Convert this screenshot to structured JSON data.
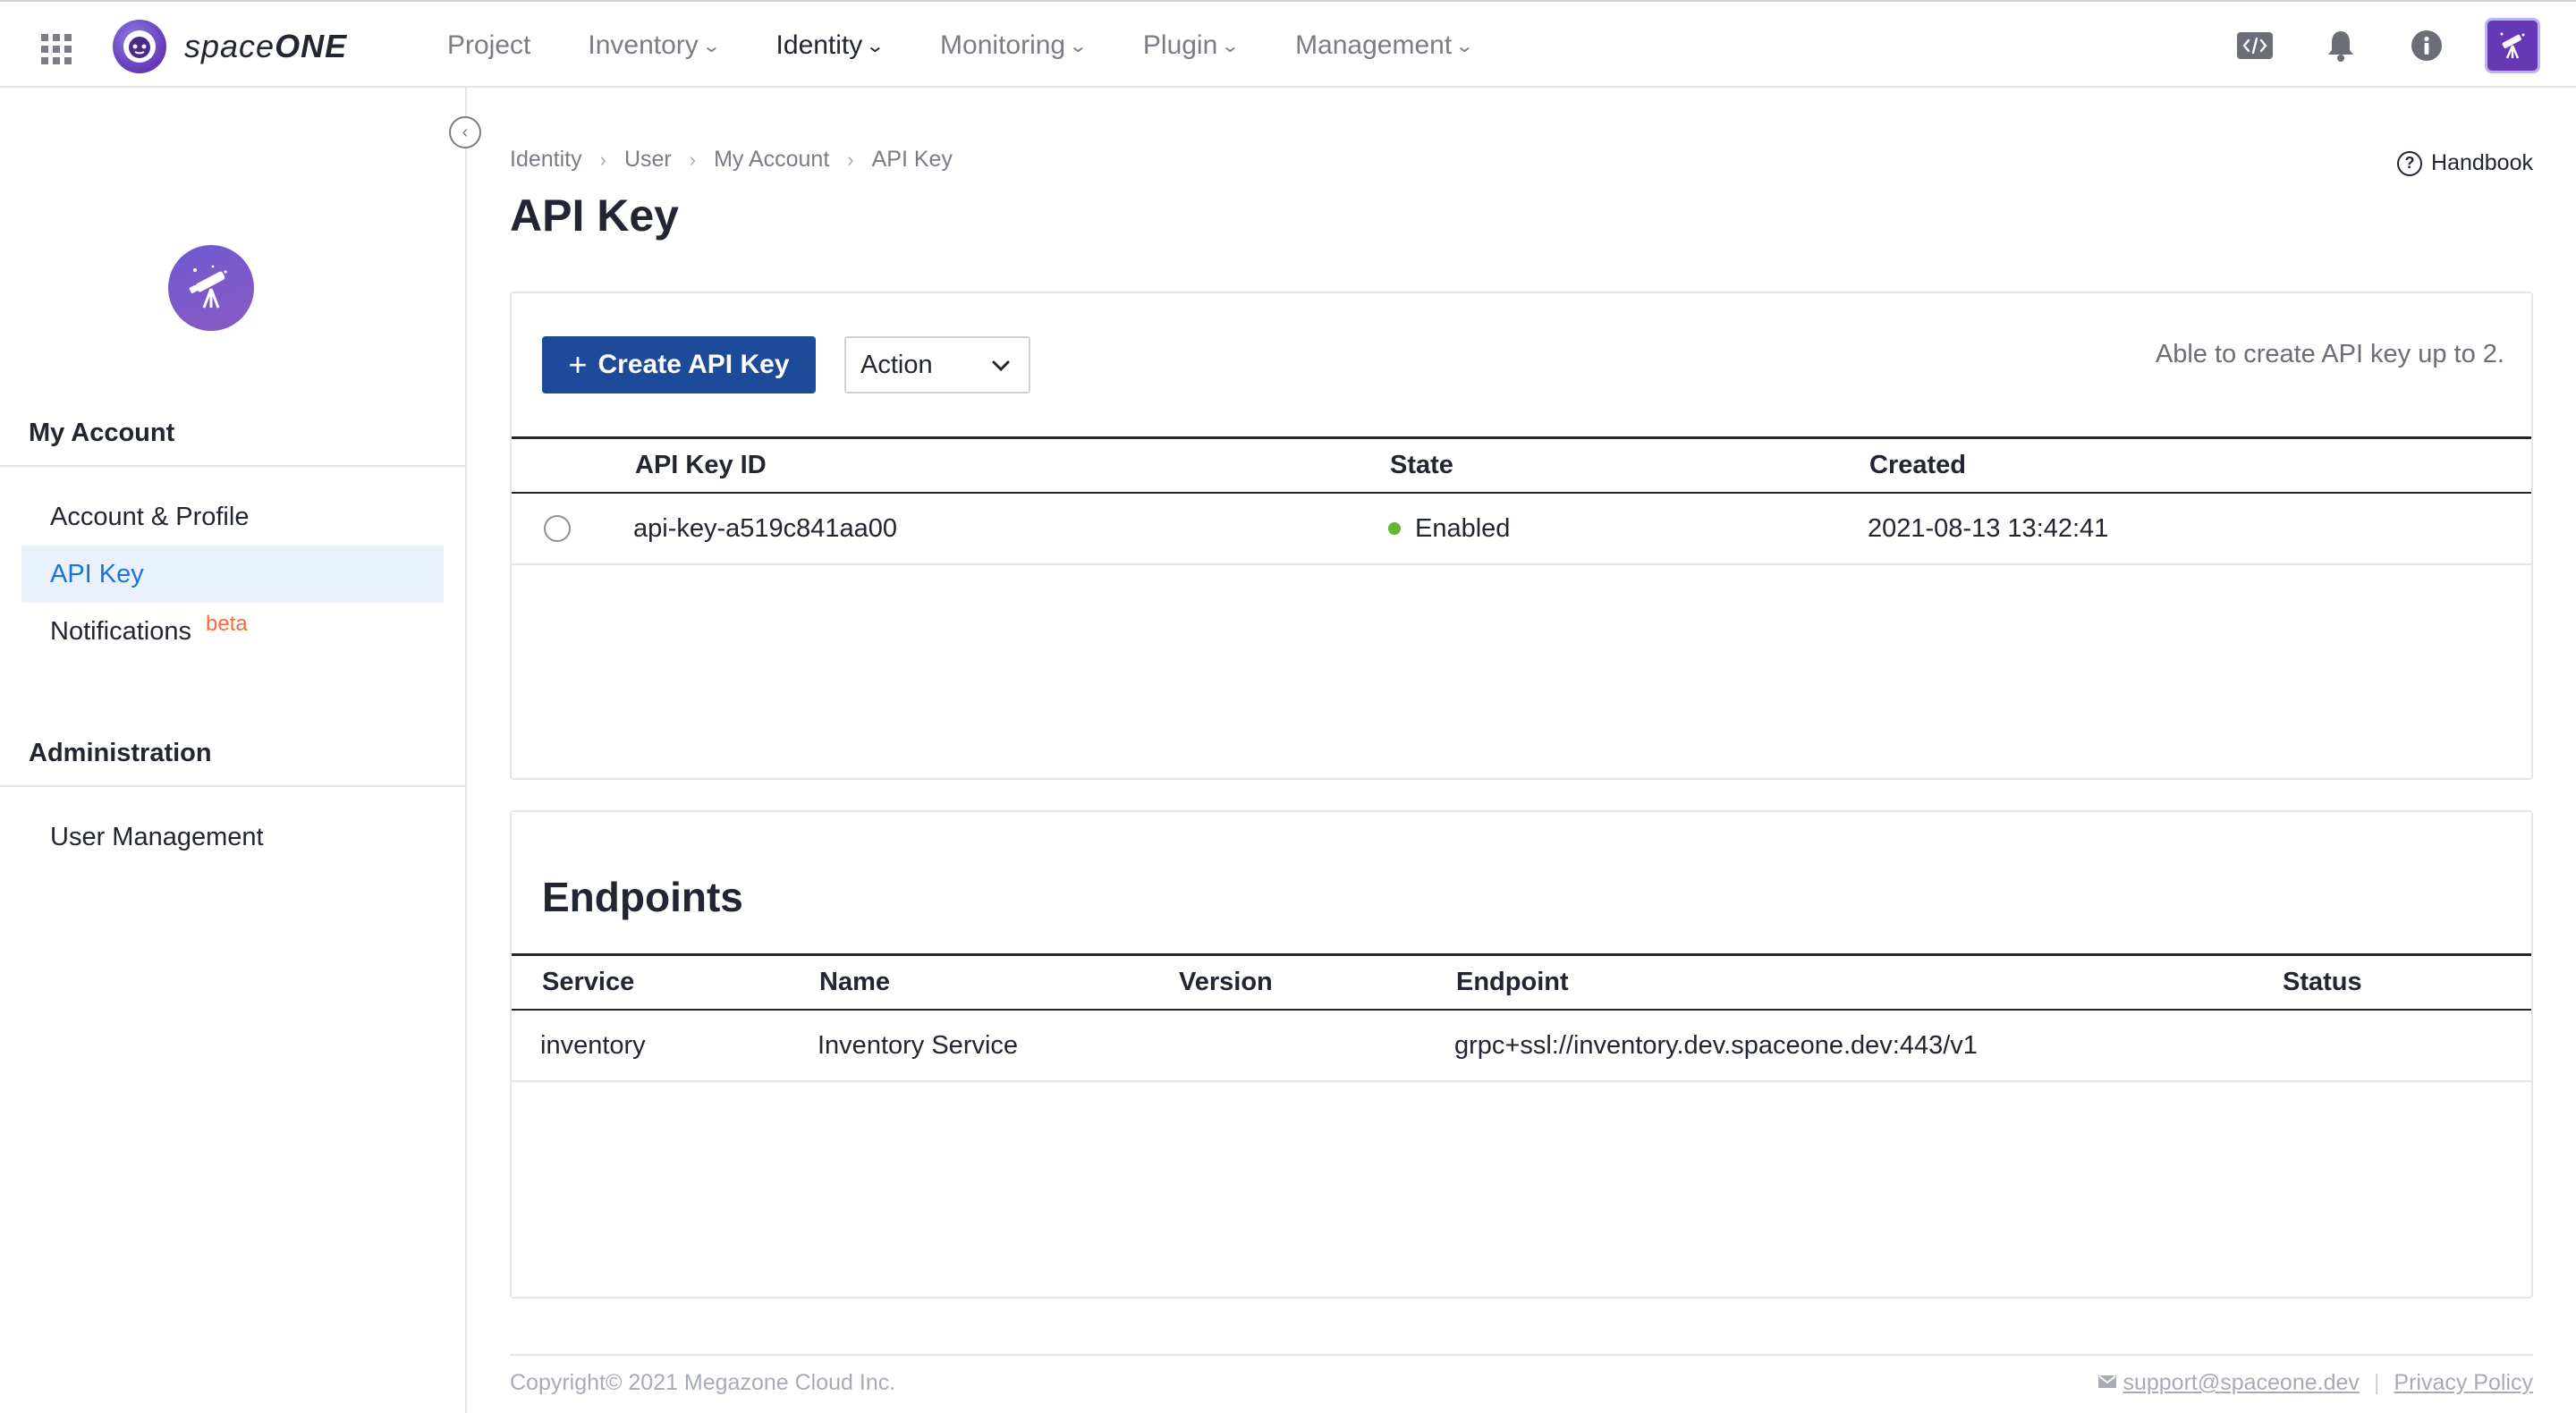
{
  "app": {
    "logo_text_light": "space",
    "logo_text_bold": "ONE",
    "brand_color": "#6638b6"
  },
  "topnav": {
    "items": [
      {
        "label": "Project",
        "has_dropdown": false
      },
      {
        "label": "Inventory",
        "has_dropdown": true
      },
      {
        "label": "Identity",
        "has_dropdown": true,
        "active": true
      },
      {
        "label": "Monitoring",
        "has_dropdown": true
      },
      {
        "label": "Plugin",
        "has_dropdown": true
      },
      {
        "label": "Management",
        "has_dropdown": true
      }
    ],
    "icons": [
      "code-icon",
      "bell-icon",
      "info-icon",
      "user-avatar"
    ]
  },
  "sidebar": {
    "sections": [
      {
        "title": "My Account",
        "items": [
          {
            "label": "Account & Profile",
            "selected": false
          },
          {
            "label": "API Key",
            "selected": true
          },
          {
            "label": "Notifications",
            "selected": false,
            "badge": "beta"
          }
        ]
      },
      {
        "title": "Administration",
        "items": [
          {
            "label": "User Management",
            "selected": false
          }
        ]
      }
    ]
  },
  "breadcrumb": [
    "Identity",
    "User",
    "My Account",
    "API Key"
  ],
  "page": {
    "title": "API Key",
    "handbook_label": "Handbook"
  },
  "apikey_card": {
    "create_button": "Create API Key",
    "action_select": "Action",
    "limit_text": "Able to create API key up to 2.",
    "columns": [
      "API Key ID",
      "State",
      "Created"
    ],
    "rows": [
      {
        "id": "api-key-a519c841aa00",
        "state": "Enabled",
        "created": "2021-08-13 13:42:41"
      }
    ],
    "state_color": "#60b731"
  },
  "endpoints_card": {
    "title": "Endpoints",
    "columns": [
      "Service",
      "Name",
      "Version",
      "Endpoint",
      "Status"
    ],
    "rows": [
      {
        "service": "inventory",
        "name": "Inventory Service",
        "version": "",
        "endpoint": "grpc+ssl://inventory.dev.spaceone.dev:443/v1",
        "status": ""
      }
    ]
  },
  "footer": {
    "copyright": "Copyright© 2021 Megazone Cloud Inc.",
    "support_email": "support@spaceone.dev",
    "privacy": "Privacy Policy"
  }
}
